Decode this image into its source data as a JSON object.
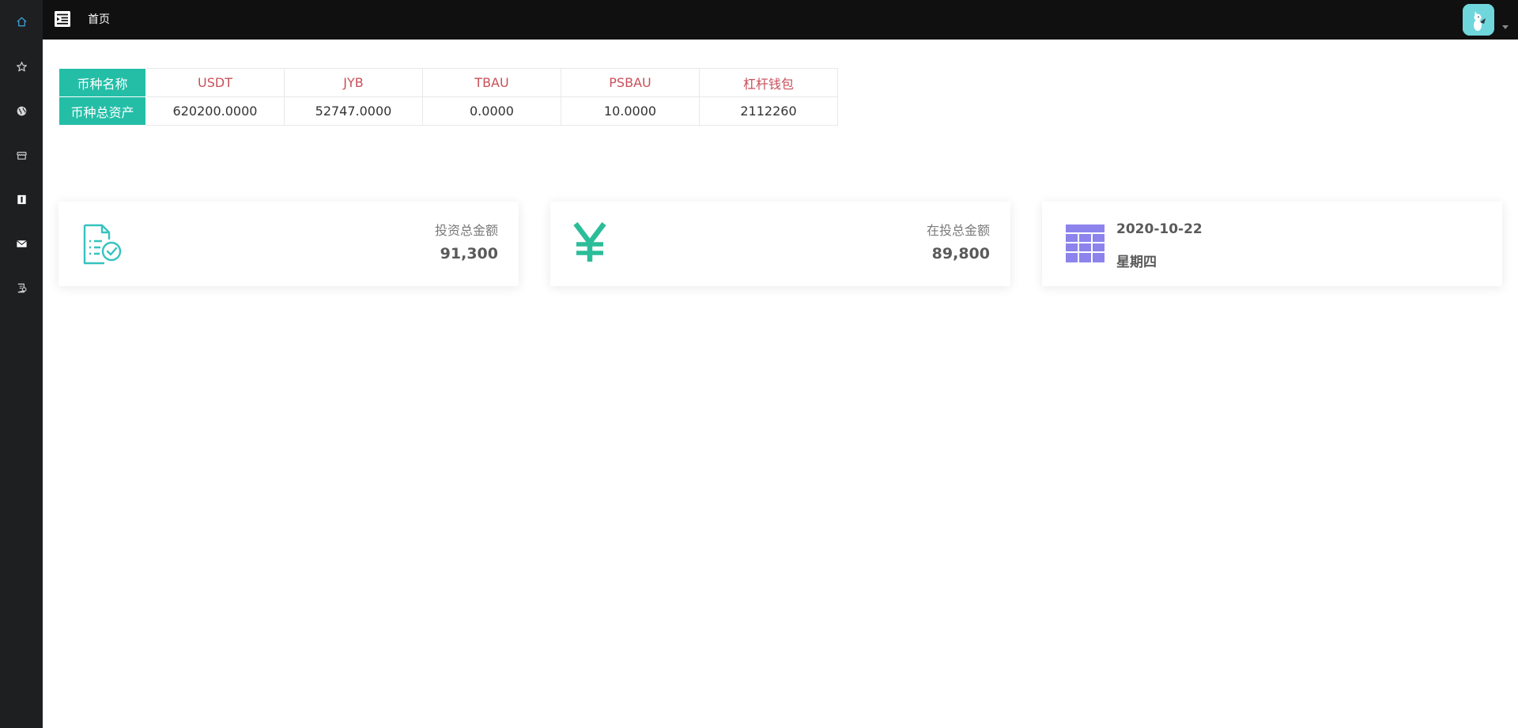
{
  "topbar": {
    "breadcrumb": "首页"
  },
  "sidebar": {
    "items": [
      {
        "icon": "home-icon",
        "active": true
      },
      {
        "icon": "star-icon"
      },
      {
        "icon": "globe-icon"
      },
      {
        "icon": "store-icon"
      },
      {
        "icon": "info-icon"
      },
      {
        "icon": "mail-icon"
      },
      {
        "icon": "report-icon"
      }
    ]
  },
  "assets": {
    "name_header": "币种名称",
    "total_header": "币种总资产",
    "coins": [
      "USDT",
      "JYB",
      "TBAU",
      "PSBAU",
      "杠杆钱包"
    ],
    "totals": [
      "620200.0000",
      "52747.0000",
      "0.0000",
      "10.0000",
      "2112260"
    ]
  },
  "stats": {
    "invest_total": {
      "label": "投资总金额",
      "value": "91,300"
    },
    "investing_total": {
      "label": "在投总金额",
      "value": "89,800"
    },
    "date": {
      "date": "2020-10-22",
      "weekday": "星期四"
    }
  },
  "colors": {
    "accent_teal": "#24bea7",
    "coin_red": "#c8505a",
    "calendar_purple": "#8c84ec",
    "topbar": "#101010",
    "sidebar": "#1e1f21"
  }
}
